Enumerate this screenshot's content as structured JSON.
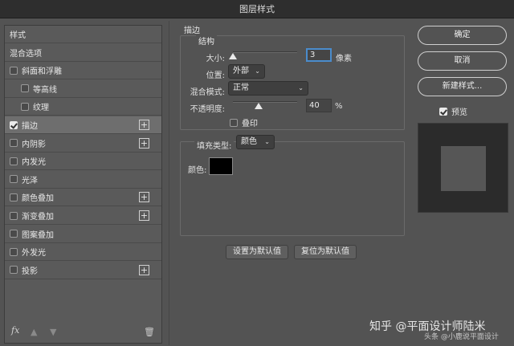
{
  "window": {
    "title": "图层样式"
  },
  "sidebar": {
    "items": [
      {
        "label": "样式",
        "checkbox": false,
        "checked": false,
        "indent": false,
        "plus": false,
        "selected": false
      },
      {
        "label": "混合选项",
        "checkbox": false,
        "checked": false,
        "indent": false,
        "plus": false,
        "selected": false
      },
      {
        "label": "斜面和浮雕",
        "checkbox": true,
        "checked": false,
        "indent": false,
        "plus": false,
        "selected": false
      },
      {
        "label": "等高线",
        "checkbox": true,
        "checked": false,
        "indent": true,
        "plus": false,
        "selected": false
      },
      {
        "label": "纹理",
        "checkbox": true,
        "checked": false,
        "indent": true,
        "plus": false,
        "selected": false
      },
      {
        "label": "描边",
        "checkbox": true,
        "checked": true,
        "indent": false,
        "plus": true,
        "selected": true
      },
      {
        "label": "内阴影",
        "checkbox": true,
        "checked": false,
        "indent": false,
        "plus": true,
        "selected": false
      },
      {
        "label": "内发光",
        "checkbox": true,
        "checked": false,
        "indent": false,
        "plus": false,
        "selected": false
      },
      {
        "label": "光泽",
        "checkbox": true,
        "checked": false,
        "indent": false,
        "plus": false,
        "selected": false
      },
      {
        "label": "颜色叠加",
        "checkbox": true,
        "checked": false,
        "indent": false,
        "plus": true,
        "selected": false
      },
      {
        "label": "渐变叠加",
        "checkbox": true,
        "checked": false,
        "indent": false,
        "plus": true,
        "selected": false
      },
      {
        "label": "图案叠加",
        "checkbox": true,
        "checked": false,
        "indent": false,
        "plus": false,
        "selected": false
      },
      {
        "label": "外发光",
        "checkbox": true,
        "checked": false,
        "indent": false,
        "plus": false,
        "selected": false
      },
      {
        "label": "投影",
        "checkbox": true,
        "checked": false,
        "indent": false,
        "plus": true,
        "selected": false
      }
    ],
    "plus_symbol": "+",
    "footer": {
      "fx": "fx",
      "up": "▲",
      "down": "▼",
      "trash": "🗑"
    }
  },
  "stroke": {
    "section_title": "描边",
    "structure_title": "结构",
    "size": {
      "label": "大小:",
      "value": "3",
      "unit": "像素",
      "level": 0.0
    },
    "position": {
      "label": "位置:",
      "value": "外部"
    },
    "blend_mode": {
      "label": "混合模式:",
      "value": "正常"
    },
    "opacity": {
      "label": "不透明度:",
      "value": "40",
      "unit": "%",
      "level": 0.4
    },
    "overprint": {
      "label": "叠印",
      "checked": false
    },
    "fill": {
      "label": "填充类型:",
      "value": "颜色"
    },
    "color": {
      "label": "颜色:",
      "value": "#000000"
    }
  },
  "buttons": {
    "set_default": "设置为默认值",
    "reset_default": "复位为默认值",
    "ok": "确定",
    "cancel": "取消",
    "new_style": "新建样式..."
  },
  "preview": {
    "label": "预览",
    "checked": true
  },
  "watermark": {
    "line1": "知乎 @平面设计师陆米",
    "line2": "头条 @小鹿说平面设计"
  },
  "colors": {
    "panel": "#535353",
    "accent_focus": "#4a8ccc",
    "swatch": "#000000"
  }
}
